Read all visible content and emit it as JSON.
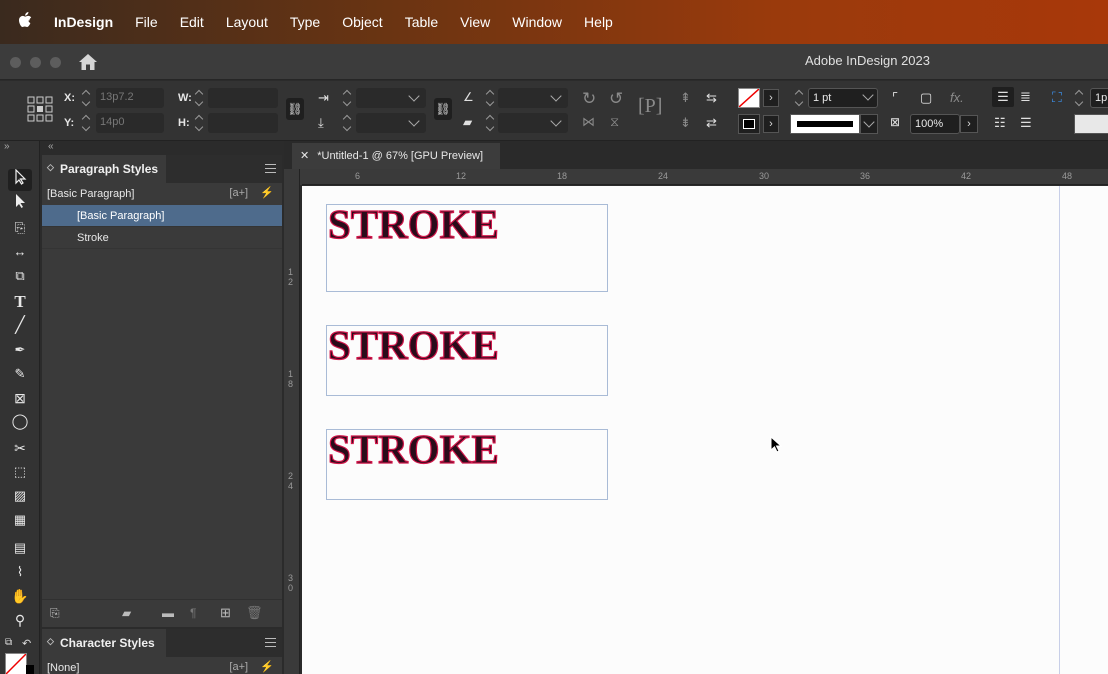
{
  "menubar": {
    "items": [
      "InDesign",
      "File",
      "Edit",
      "Layout",
      "Type",
      "Object",
      "Table",
      "View",
      "Window",
      "Help"
    ]
  },
  "window": {
    "title": "Adobe InDesign 2023"
  },
  "controls": {
    "x_label": "X:",
    "x_value": "13p7.2",
    "y_label": "Y:",
    "y_value": "14p0",
    "w_label": "W:",
    "h_label": "H:",
    "stroke_weight": "1 pt",
    "opacity": "100%",
    "partial_right": "1p"
  },
  "paragraph_panel": {
    "title": "Paragraph Styles",
    "current": "[Basic Paragraph]",
    "styles": [
      "[Basic Paragraph]",
      "Stroke"
    ],
    "selected_index": 0
  },
  "character_panel": {
    "title": "Character Styles",
    "current": "[None]"
  },
  "document": {
    "tab_title": "*Untitled-1 @ 67% [GPU Preview]",
    "h_ruler": [
      "6",
      "12",
      "18",
      "24",
      "30",
      "36",
      "42",
      "48"
    ],
    "v_ruler": [
      "1\n2",
      "1\n8",
      "2\n4",
      "3\n0"
    ],
    "frames": [
      {
        "text": "STROKE"
      },
      {
        "text": "STROKE"
      },
      {
        "text": "STROKE"
      }
    ]
  },
  "colors": {
    "stroke": "#d0164a",
    "fill": "#2a0b1a",
    "selection": "#4e6b8c"
  }
}
